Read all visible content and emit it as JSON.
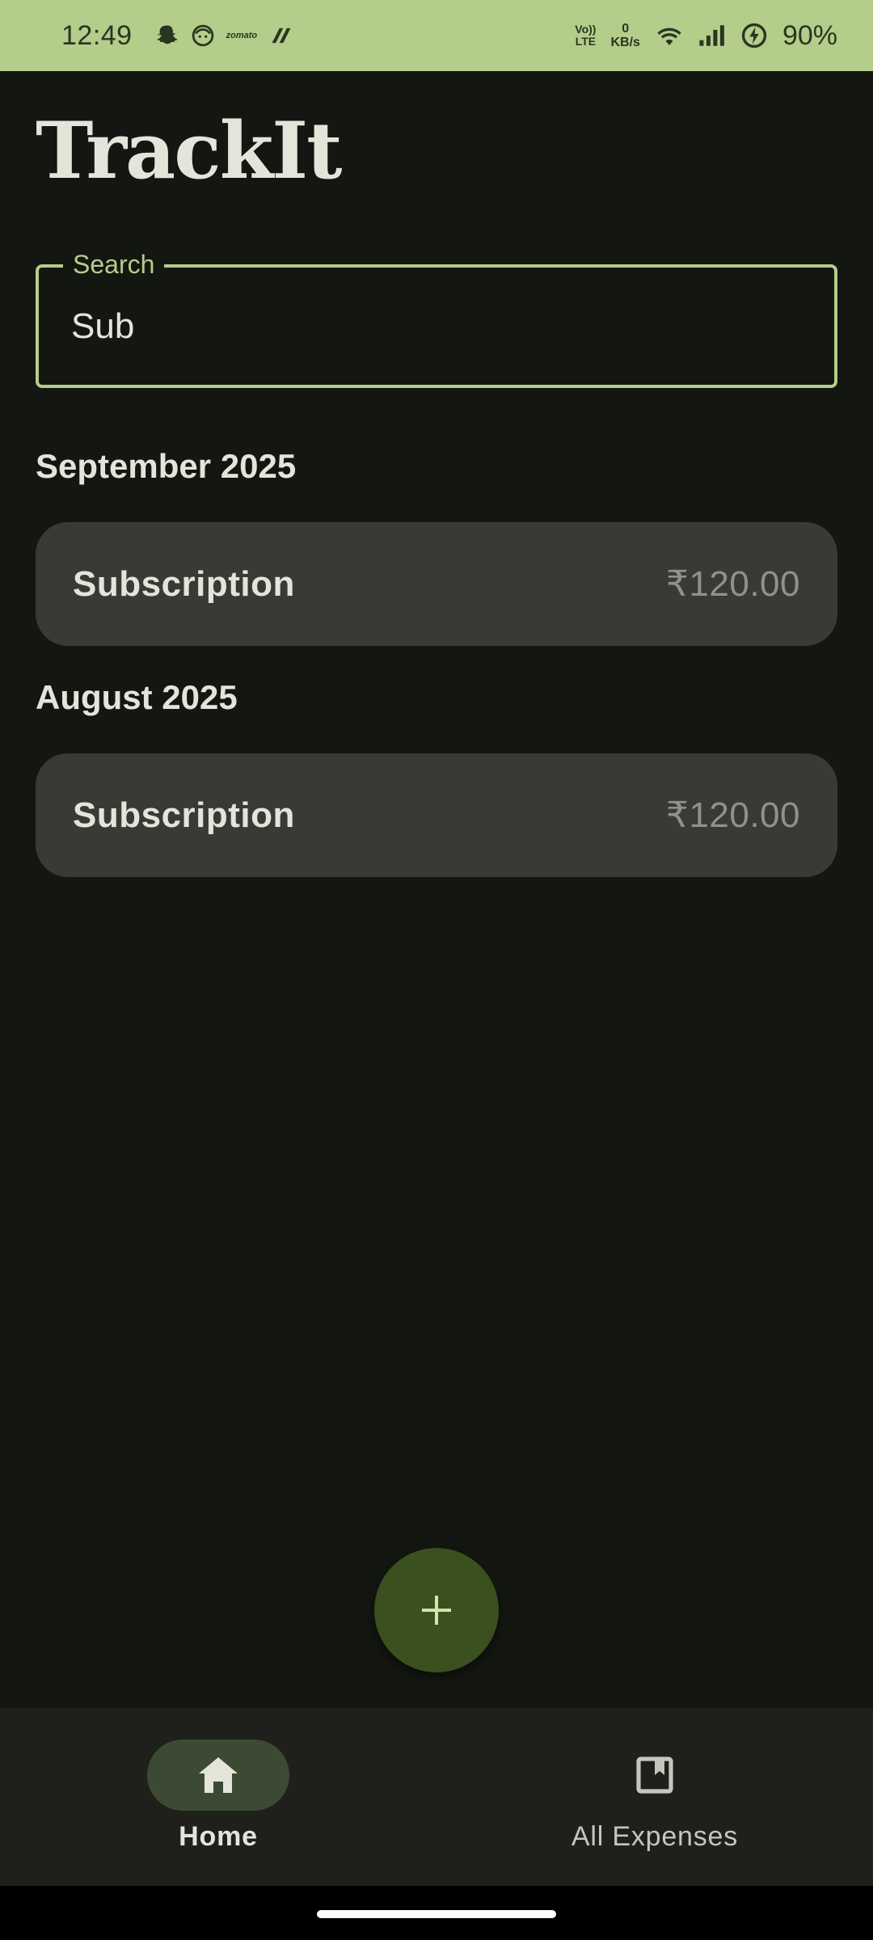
{
  "status_bar": {
    "time": "12:49",
    "volte_top": "Vo))",
    "volte_bottom": "LTE",
    "network_speed_value": "0",
    "network_speed_unit": "KB/s",
    "battery_percent": "90%",
    "notification_icons": [
      "snapchat-icon",
      "face-icon",
      "zomato-icon",
      "swiggy-icon"
    ],
    "zomato_text": "zomato"
  },
  "app": {
    "title": "TrackIt"
  },
  "search": {
    "label": "Search",
    "value": "Sub"
  },
  "sections": [
    {
      "month": "September 2025",
      "expenses": [
        {
          "name": "Subscription",
          "amount": "₹120.00"
        }
      ]
    },
    {
      "month": "August 2025",
      "expenses": [
        {
          "name": "Subscription",
          "amount": "₹120.00"
        }
      ]
    }
  ],
  "fab": {
    "icon": "plus-icon"
  },
  "bottom_nav": {
    "items": [
      {
        "label": "Home",
        "icon": "home-icon",
        "selected": true
      },
      {
        "label": "All Expenses",
        "icon": "bookmark-icon",
        "selected": false
      }
    ]
  },
  "colors": {
    "status_bar": "#b3cd8b",
    "background": "#141612",
    "accent": "#b3cd8b",
    "card": "#393a35",
    "fab": "#3a501f",
    "nav_background": "#1f201c",
    "nav_pill": "#3c4a33"
  }
}
